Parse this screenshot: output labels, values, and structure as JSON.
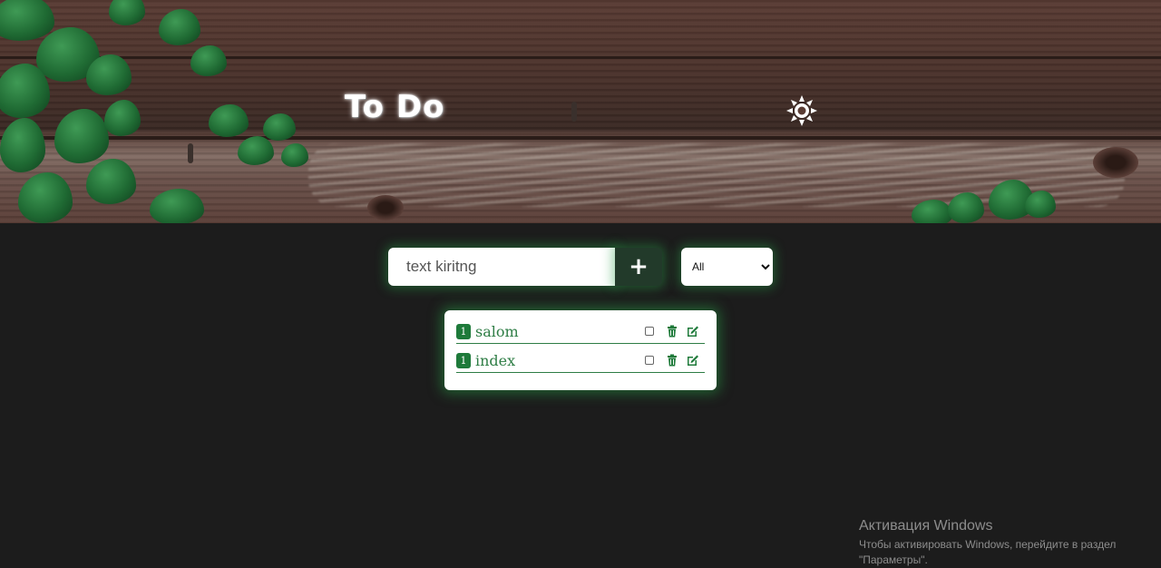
{
  "header": {
    "title": "To Do",
    "theme_icon": "sun-icon"
  },
  "form": {
    "input_placeholder": "text kiritng",
    "input_value": "",
    "add_label": "+"
  },
  "filter": {
    "selected": "All",
    "options": [
      "All"
    ]
  },
  "todos": [
    {
      "number": "1",
      "text": "salom",
      "done": false
    },
    {
      "number": "1",
      "text": "index",
      "done": false
    }
  ],
  "watermark": {
    "title": "Активация Windows",
    "subtitle": "Чтобы активировать Windows, перейдите в раздел \"Параметры\"."
  },
  "colors": {
    "accent": "#1e7a3a",
    "background": "#1c1c1c",
    "glow": "#28a046"
  }
}
